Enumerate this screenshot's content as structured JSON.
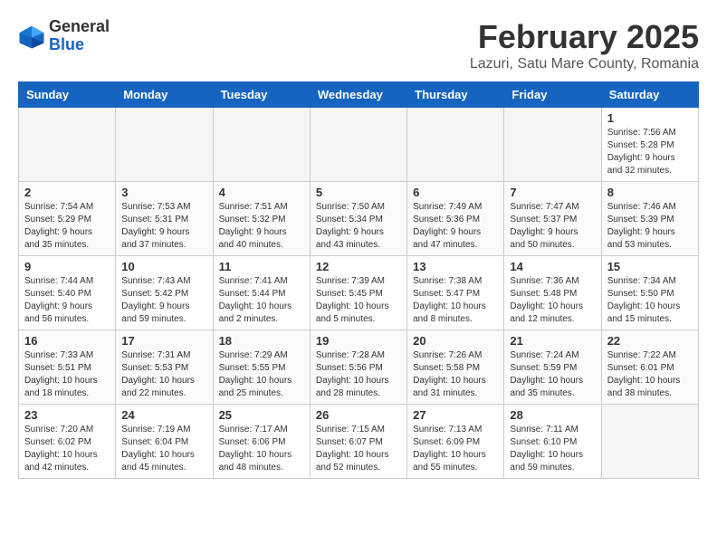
{
  "logo": {
    "general": "General",
    "blue": "Blue"
  },
  "title": "February 2025",
  "subtitle": "Lazuri, Satu Mare County, Romania",
  "days_of_week": [
    "Sunday",
    "Monday",
    "Tuesday",
    "Wednesday",
    "Thursday",
    "Friday",
    "Saturday"
  ],
  "weeks": [
    [
      {
        "day": "",
        "info": ""
      },
      {
        "day": "",
        "info": ""
      },
      {
        "day": "",
        "info": ""
      },
      {
        "day": "",
        "info": ""
      },
      {
        "day": "",
        "info": ""
      },
      {
        "day": "",
        "info": ""
      },
      {
        "day": "1",
        "info": "Sunrise: 7:56 AM\nSunset: 5:28 PM\nDaylight: 9 hours and 32 minutes."
      }
    ],
    [
      {
        "day": "2",
        "info": "Sunrise: 7:54 AM\nSunset: 5:29 PM\nDaylight: 9 hours and 35 minutes."
      },
      {
        "day": "3",
        "info": "Sunrise: 7:53 AM\nSunset: 5:31 PM\nDaylight: 9 hours and 37 minutes."
      },
      {
        "day": "4",
        "info": "Sunrise: 7:51 AM\nSunset: 5:32 PM\nDaylight: 9 hours and 40 minutes."
      },
      {
        "day": "5",
        "info": "Sunrise: 7:50 AM\nSunset: 5:34 PM\nDaylight: 9 hours and 43 minutes."
      },
      {
        "day": "6",
        "info": "Sunrise: 7:49 AM\nSunset: 5:36 PM\nDaylight: 9 hours and 47 minutes."
      },
      {
        "day": "7",
        "info": "Sunrise: 7:47 AM\nSunset: 5:37 PM\nDaylight: 9 hours and 50 minutes."
      },
      {
        "day": "8",
        "info": "Sunrise: 7:46 AM\nSunset: 5:39 PM\nDaylight: 9 hours and 53 minutes."
      }
    ],
    [
      {
        "day": "9",
        "info": "Sunrise: 7:44 AM\nSunset: 5:40 PM\nDaylight: 9 hours and 56 minutes."
      },
      {
        "day": "10",
        "info": "Sunrise: 7:43 AM\nSunset: 5:42 PM\nDaylight: 9 hours and 59 minutes."
      },
      {
        "day": "11",
        "info": "Sunrise: 7:41 AM\nSunset: 5:44 PM\nDaylight: 10 hours and 2 minutes."
      },
      {
        "day": "12",
        "info": "Sunrise: 7:39 AM\nSunset: 5:45 PM\nDaylight: 10 hours and 5 minutes."
      },
      {
        "day": "13",
        "info": "Sunrise: 7:38 AM\nSunset: 5:47 PM\nDaylight: 10 hours and 8 minutes."
      },
      {
        "day": "14",
        "info": "Sunrise: 7:36 AM\nSunset: 5:48 PM\nDaylight: 10 hours and 12 minutes."
      },
      {
        "day": "15",
        "info": "Sunrise: 7:34 AM\nSunset: 5:50 PM\nDaylight: 10 hours and 15 minutes."
      }
    ],
    [
      {
        "day": "16",
        "info": "Sunrise: 7:33 AM\nSunset: 5:51 PM\nDaylight: 10 hours and 18 minutes."
      },
      {
        "day": "17",
        "info": "Sunrise: 7:31 AM\nSunset: 5:53 PM\nDaylight: 10 hours and 22 minutes."
      },
      {
        "day": "18",
        "info": "Sunrise: 7:29 AM\nSunset: 5:55 PM\nDaylight: 10 hours and 25 minutes."
      },
      {
        "day": "19",
        "info": "Sunrise: 7:28 AM\nSunset: 5:56 PM\nDaylight: 10 hours and 28 minutes."
      },
      {
        "day": "20",
        "info": "Sunrise: 7:26 AM\nSunset: 5:58 PM\nDaylight: 10 hours and 31 minutes."
      },
      {
        "day": "21",
        "info": "Sunrise: 7:24 AM\nSunset: 5:59 PM\nDaylight: 10 hours and 35 minutes."
      },
      {
        "day": "22",
        "info": "Sunrise: 7:22 AM\nSunset: 6:01 PM\nDaylight: 10 hours and 38 minutes."
      }
    ],
    [
      {
        "day": "23",
        "info": "Sunrise: 7:20 AM\nSunset: 6:02 PM\nDaylight: 10 hours and 42 minutes."
      },
      {
        "day": "24",
        "info": "Sunrise: 7:19 AM\nSunset: 6:04 PM\nDaylight: 10 hours and 45 minutes."
      },
      {
        "day": "25",
        "info": "Sunrise: 7:17 AM\nSunset: 6:06 PM\nDaylight: 10 hours and 48 minutes."
      },
      {
        "day": "26",
        "info": "Sunrise: 7:15 AM\nSunset: 6:07 PM\nDaylight: 10 hours and 52 minutes."
      },
      {
        "day": "27",
        "info": "Sunrise: 7:13 AM\nSunset: 6:09 PM\nDaylight: 10 hours and 55 minutes."
      },
      {
        "day": "28",
        "info": "Sunrise: 7:11 AM\nSunset: 6:10 PM\nDaylight: 10 hours and 59 minutes."
      },
      {
        "day": "",
        "info": ""
      }
    ]
  ]
}
